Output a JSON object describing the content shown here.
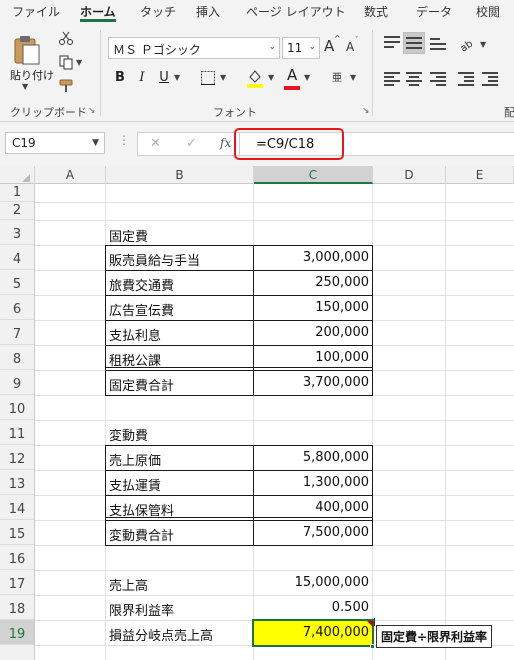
{
  "ribbon": {
    "tabs": [
      "ファイル",
      "ホーム",
      "タッチ",
      "挿入",
      "ページ レイアウト",
      "数式",
      "データ",
      "校閲"
    ],
    "active_tab": "ホーム",
    "paste_label": "貼り付け",
    "clipboard_label": "クリップボード",
    "font_group_label": "フォント",
    "font_name": "ＭＳ Ｐゴシック",
    "font_size": "11",
    "grow_font": "A",
    "shrink_font": "A",
    "bold": "B",
    "italic": "I",
    "underline": "U",
    "font_color_glyph": "A",
    "phonetic_glyph": "亜",
    "align_group_partial": "配",
    "fill_color": "#ffff00",
    "font_color": "#e8161c"
  },
  "formula_bar": {
    "name_box": "C19",
    "formula": "=C9/C18",
    "fx": "fx",
    "cancel": "✕",
    "enter": "✓"
  },
  "sheet": {
    "columns": [
      "A",
      "B",
      "C",
      "D",
      "E"
    ],
    "rows": [
      "1",
      "2",
      "3",
      "4",
      "5",
      "6",
      "7",
      "8",
      "9",
      "10",
      "11",
      "12",
      "13",
      "14",
      "15",
      "16",
      "17",
      "18",
      "19"
    ],
    "fixed_cost": {
      "header": "固定費",
      "items": [
        {
          "label": "販売員給与手当",
          "value": "3,000,000"
        },
        {
          "label": "旅費交通費",
          "value": "250,000"
        },
        {
          "label": "広告宣伝費",
          "value": "150,000"
        },
        {
          "label": "支払利息",
          "value": "200,000"
        },
        {
          "label": "租税公課",
          "value": "100,000"
        }
      ],
      "total_label": "固定費合計",
      "total_value": "3,700,000"
    },
    "variable_cost": {
      "header": "変動費",
      "items": [
        {
          "label": "売上原価",
          "value": "5,800,000"
        },
        {
          "label": "支払運賃",
          "value": "1,300,000"
        },
        {
          "label": "支払保管料",
          "value": "400,000"
        }
      ],
      "total_label": "変動費合計",
      "total_value": "7,500,000"
    },
    "summary": [
      {
        "label": "売上高",
        "value": "15,000,000"
      },
      {
        "label": "限界利益率",
        "value": "0.500"
      },
      {
        "label": "損益分岐点売上高",
        "value": "7,400,000"
      }
    ],
    "comment": "固定費÷限界利益率",
    "highlight_color": "#ffff00",
    "annotation_color": "#e8161c"
  }
}
